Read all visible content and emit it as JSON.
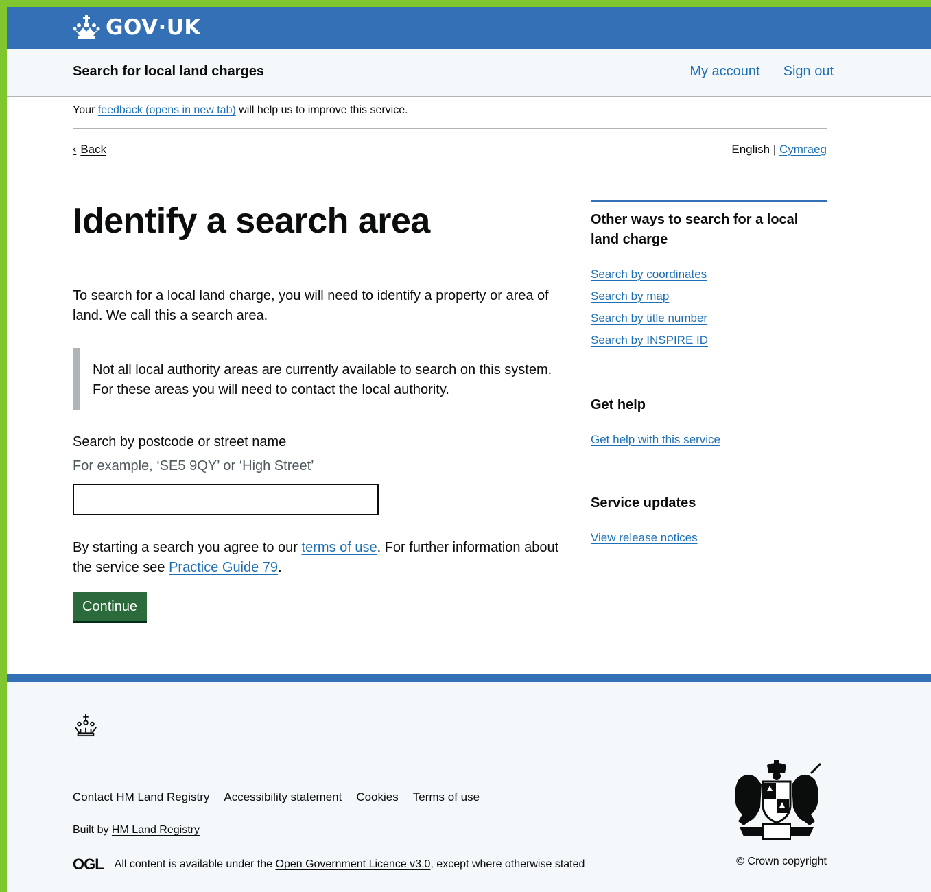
{
  "header": {
    "logo_text": "GOV·UK",
    "service_name": "Search for local land charges",
    "nav": [
      "My account",
      "Sign out"
    ]
  },
  "feedback": {
    "prefix": "Your",
    "link": "feedback (opens in new tab)",
    "suffix": "will help us to improve this service."
  },
  "back_link": "Back",
  "language": {
    "current": "English",
    "separator": "|",
    "other": "Cymraeg"
  },
  "main": {
    "title": "Identify a search area",
    "lead": "To search for a local land charge, you will need to identify a property or area of land. We call this a search area.",
    "inset": "Not all local authority areas are currently available to search on this system. For these areas you will need to contact the local authority.",
    "search_label": "Search by postcode or street name",
    "search_hint": "For example, ‘SE5 9QY’ or ‘High Street’",
    "search_value": "",
    "terms_prefix": "By starting a search you agree to our",
    "terms_link": "terms of use",
    "terms_middle": ". For further information about the service see",
    "guide_link": "Practice Guide 79",
    "terms_end": ".",
    "continue_label": "Continue"
  },
  "sidebar": {
    "other_ways_heading": "Other ways to search for a local land charge",
    "other_ways_links": [
      "Search by coordinates",
      "Search by map",
      "Search by title number",
      "Search by INSPIRE ID"
    ],
    "help_heading": "Get help",
    "help_link": "Get help with this service",
    "updates_heading": "Service updates",
    "updates_link": "View release notices"
  },
  "footer": {
    "links": [
      "Contact HM Land Registry",
      "Accessibility statement",
      "Cookies",
      "Terms of use"
    ],
    "built_by_prefix": "Built by",
    "built_by_link": "HM Land Registry",
    "ogl": "OGL",
    "licence_prefix": "All content is available under the",
    "licence_link": "Open Government Licence v3.0",
    "licence_suffix": ", except where otherwise stated",
    "copyright": "© Crown copyright"
  },
  "colors": {
    "header_blue": "#3470b5",
    "link_blue": "#1d70b8",
    "button_green": "#2b6a3b",
    "outer_border": "#7fc62f"
  },
  "icons": [
    "crown-icon",
    "chevron-left-icon",
    "royal-crest-icon"
  ]
}
